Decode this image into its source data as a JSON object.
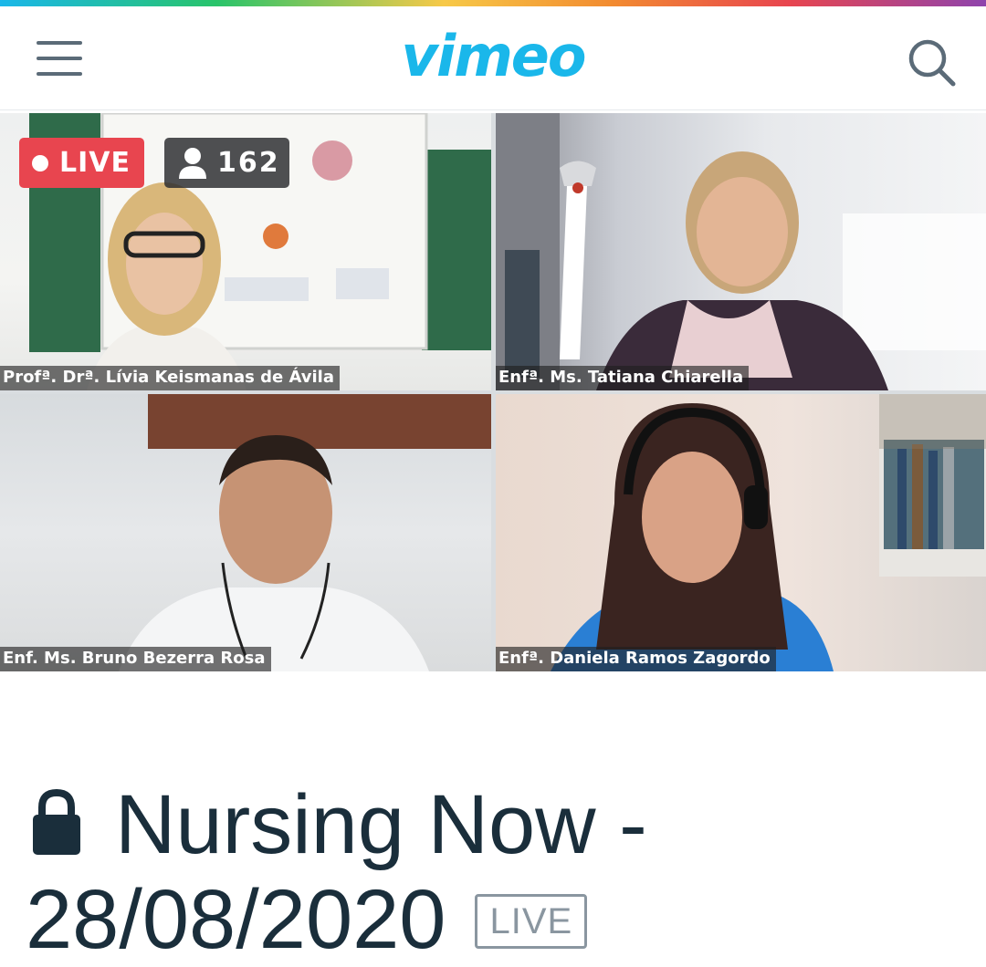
{
  "header": {
    "logo": "vimeo",
    "menu_icon": "hamburger-menu-icon",
    "search_icon": "search-icon",
    "brand_color": "#1ab7ea"
  },
  "stream": {
    "live_label": "LIVE",
    "viewer_count": "162",
    "live_color": "#e8454f"
  },
  "participants": [
    {
      "name": "Profª. Drª. Lívia Keismanas de Ávila"
    },
    {
      "name": "Enfª. Ms. Tatiana Chiarella"
    },
    {
      "name": "Enf. Ms. Bruno Bezerra Rosa"
    },
    {
      "name": "Enfª. Daniela Ramos Zagordo"
    }
  ],
  "video": {
    "title": "Nursing Now - 28/08/2020",
    "badge": "LIVE",
    "title_color": "#1a2e3b"
  }
}
